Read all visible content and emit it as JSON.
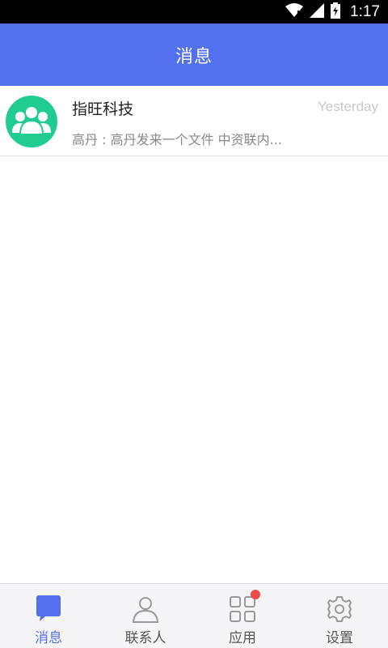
{
  "status_bar": {
    "time": "1:17"
  },
  "header": {
    "title": "消息"
  },
  "conversations": [
    {
      "name": "指旺科技",
      "time": "Yesterday",
      "preview": "高丹 : 高丹发来一个文件 中资联内..."
    }
  ],
  "tabs": [
    {
      "label": "消息",
      "icon": "chat-bubble-icon",
      "active": true
    },
    {
      "label": "联系人",
      "icon": "person-icon",
      "active": false
    },
    {
      "label": "应用",
      "icon": "apps-grid-icon",
      "active": false,
      "badge": true
    },
    {
      "label": "设置",
      "icon": "gear-icon",
      "active": false
    }
  ],
  "colors": {
    "primary": "#5370ee",
    "avatar_bg": "#21cc91",
    "badge": "#f24b4b",
    "tab_inactive": "#888888"
  }
}
